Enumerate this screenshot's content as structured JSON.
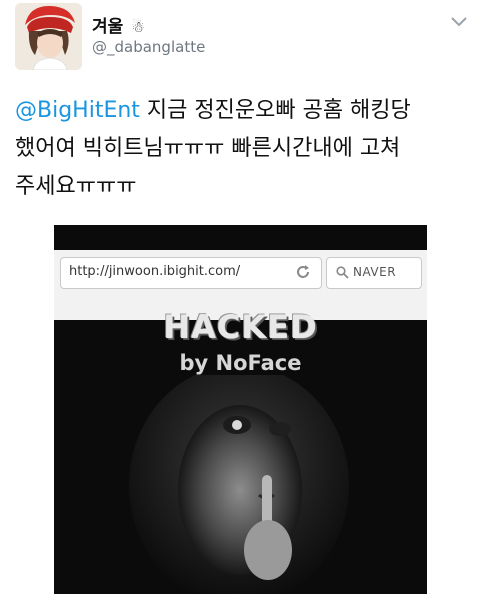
{
  "tweet": {
    "author_name": "겨울",
    "author_emoji": "☃",
    "handle": "@_dabanglatte",
    "mention": "@BigHitEnt",
    "text_after_mention": " 지금 정진운오빠 공홈 해킹당\n했어여 빅히트님ㅠㅠㅠ 빠른시간내에 고쳐\n주세요ㅠㅠㅠ"
  },
  "media": {
    "url": "http://jinwoon.ibighit.com/",
    "search_label": "NAVER",
    "headline": "HACKED",
    "byline": "by NoFace"
  },
  "colors": {
    "mention": "#1b95e0",
    "handle": "#6e7781",
    "media_bg": "#0b0b0b"
  }
}
